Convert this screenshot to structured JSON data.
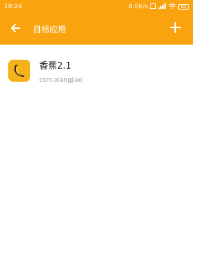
{
  "status": {
    "time": "18:24",
    "speed": "0.0K/s",
    "battery": "84"
  },
  "appbar": {
    "title": "目标应用",
    "back_icon": "arrow-left-icon",
    "add_icon": "plus-icon"
  },
  "apps": [
    {
      "name": "香蕉2.1",
      "package": "com.xiangjiao",
      "icon": "banana-icon"
    }
  ],
  "colors": {
    "accent": "#f9a30f",
    "app_icon_bg": "#f6b21a"
  }
}
